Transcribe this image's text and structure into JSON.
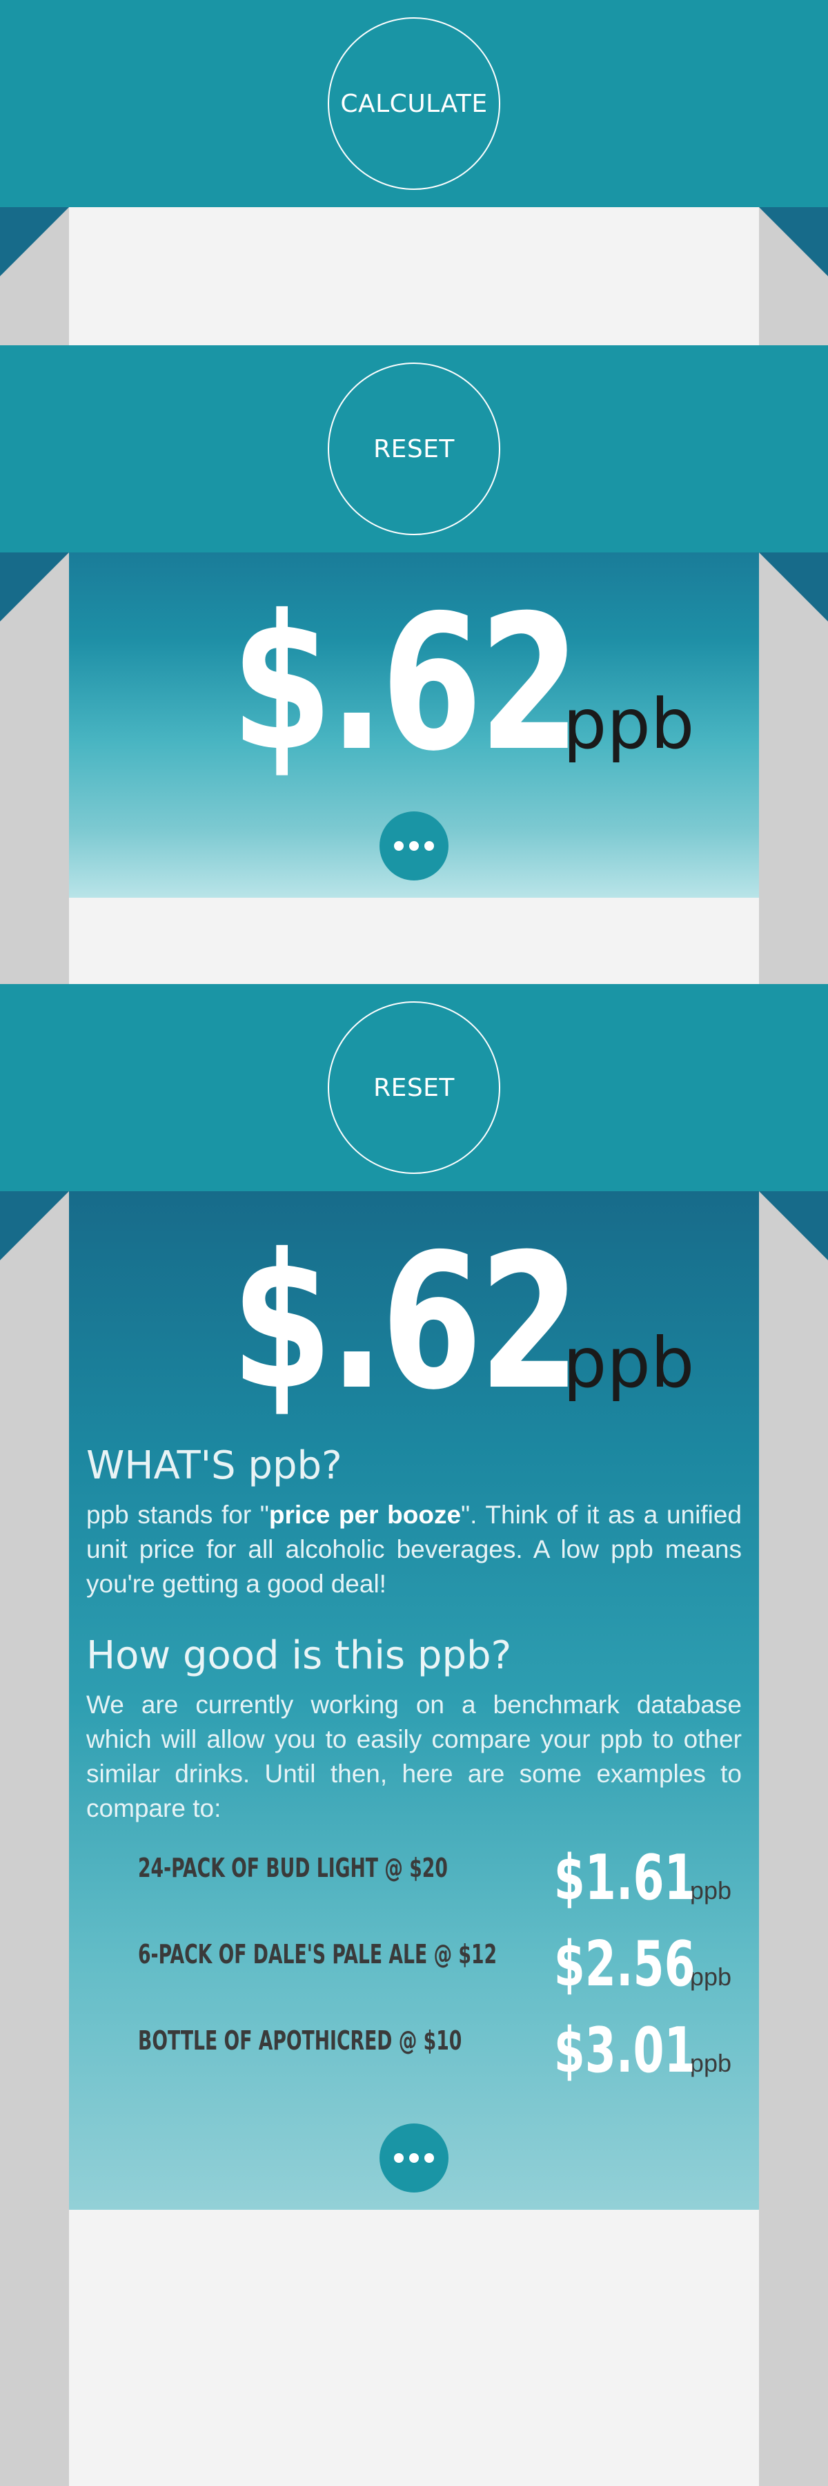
{
  "screens": {
    "calculate_label": "CALCULATE",
    "reset_label_1": "RESET",
    "reset_label_2": "RESET"
  },
  "result": {
    "price": "$.62",
    "unit": "ppb"
  },
  "info": {
    "whats_heading": "WHAT'S ppb?",
    "whats_text_before": "ppb stands for \"",
    "whats_text_bold": "price per booze",
    "whats_text_after": "\". Think of it as a unified unit price for all alcoholic beverages. A low ppb means you're getting a good deal!",
    "good_heading": "How good is this ppb?",
    "good_text": "We are currently working on a benchmark database which will allow you to easily compare your ppb to other similar drinks. Until then, here are some examples to compare to:"
  },
  "examples": [
    {
      "label": "24-PACK OF BUD LIGHT @ $20",
      "value": "$1.61",
      "unit": "ppb"
    },
    {
      "label": "6-PACK OF DALE'S PALE ALE @ $12",
      "value": "$2.56",
      "unit": "ppb"
    },
    {
      "label": "BOTTLE OF APOTHICRED @ $10",
      "value": "$3.01",
      "unit": "ppb"
    }
  ],
  "colors": {
    "teal": "#1a95a5",
    "dark_teal": "#176b8a",
    "light_gray": "#f3f3f3",
    "side_gray": "#cfcfcf"
  },
  "icons": {
    "more": "ellipsis-icon"
  }
}
